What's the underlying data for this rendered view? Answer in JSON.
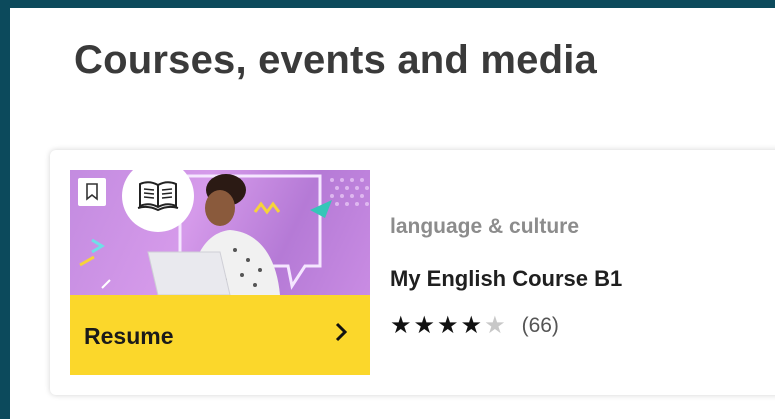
{
  "page": {
    "title": "Courses, events and media"
  },
  "course_card": {
    "category": "language & culture",
    "title": "My English Course B1",
    "resume_label": "Resume",
    "rating": 4,
    "rating_max": 5,
    "rating_count": "(66)",
    "icons": {
      "bookmark": "bookmark-icon",
      "course_type": "open-book-icon",
      "resume": "chevron-right-icon",
      "star": "star-icon"
    },
    "colors": {
      "resume_bar": "#fbd72b",
      "thumbnail_bg": "#c98ce3"
    }
  },
  "frame": {
    "background": "#0c4a5c"
  }
}
